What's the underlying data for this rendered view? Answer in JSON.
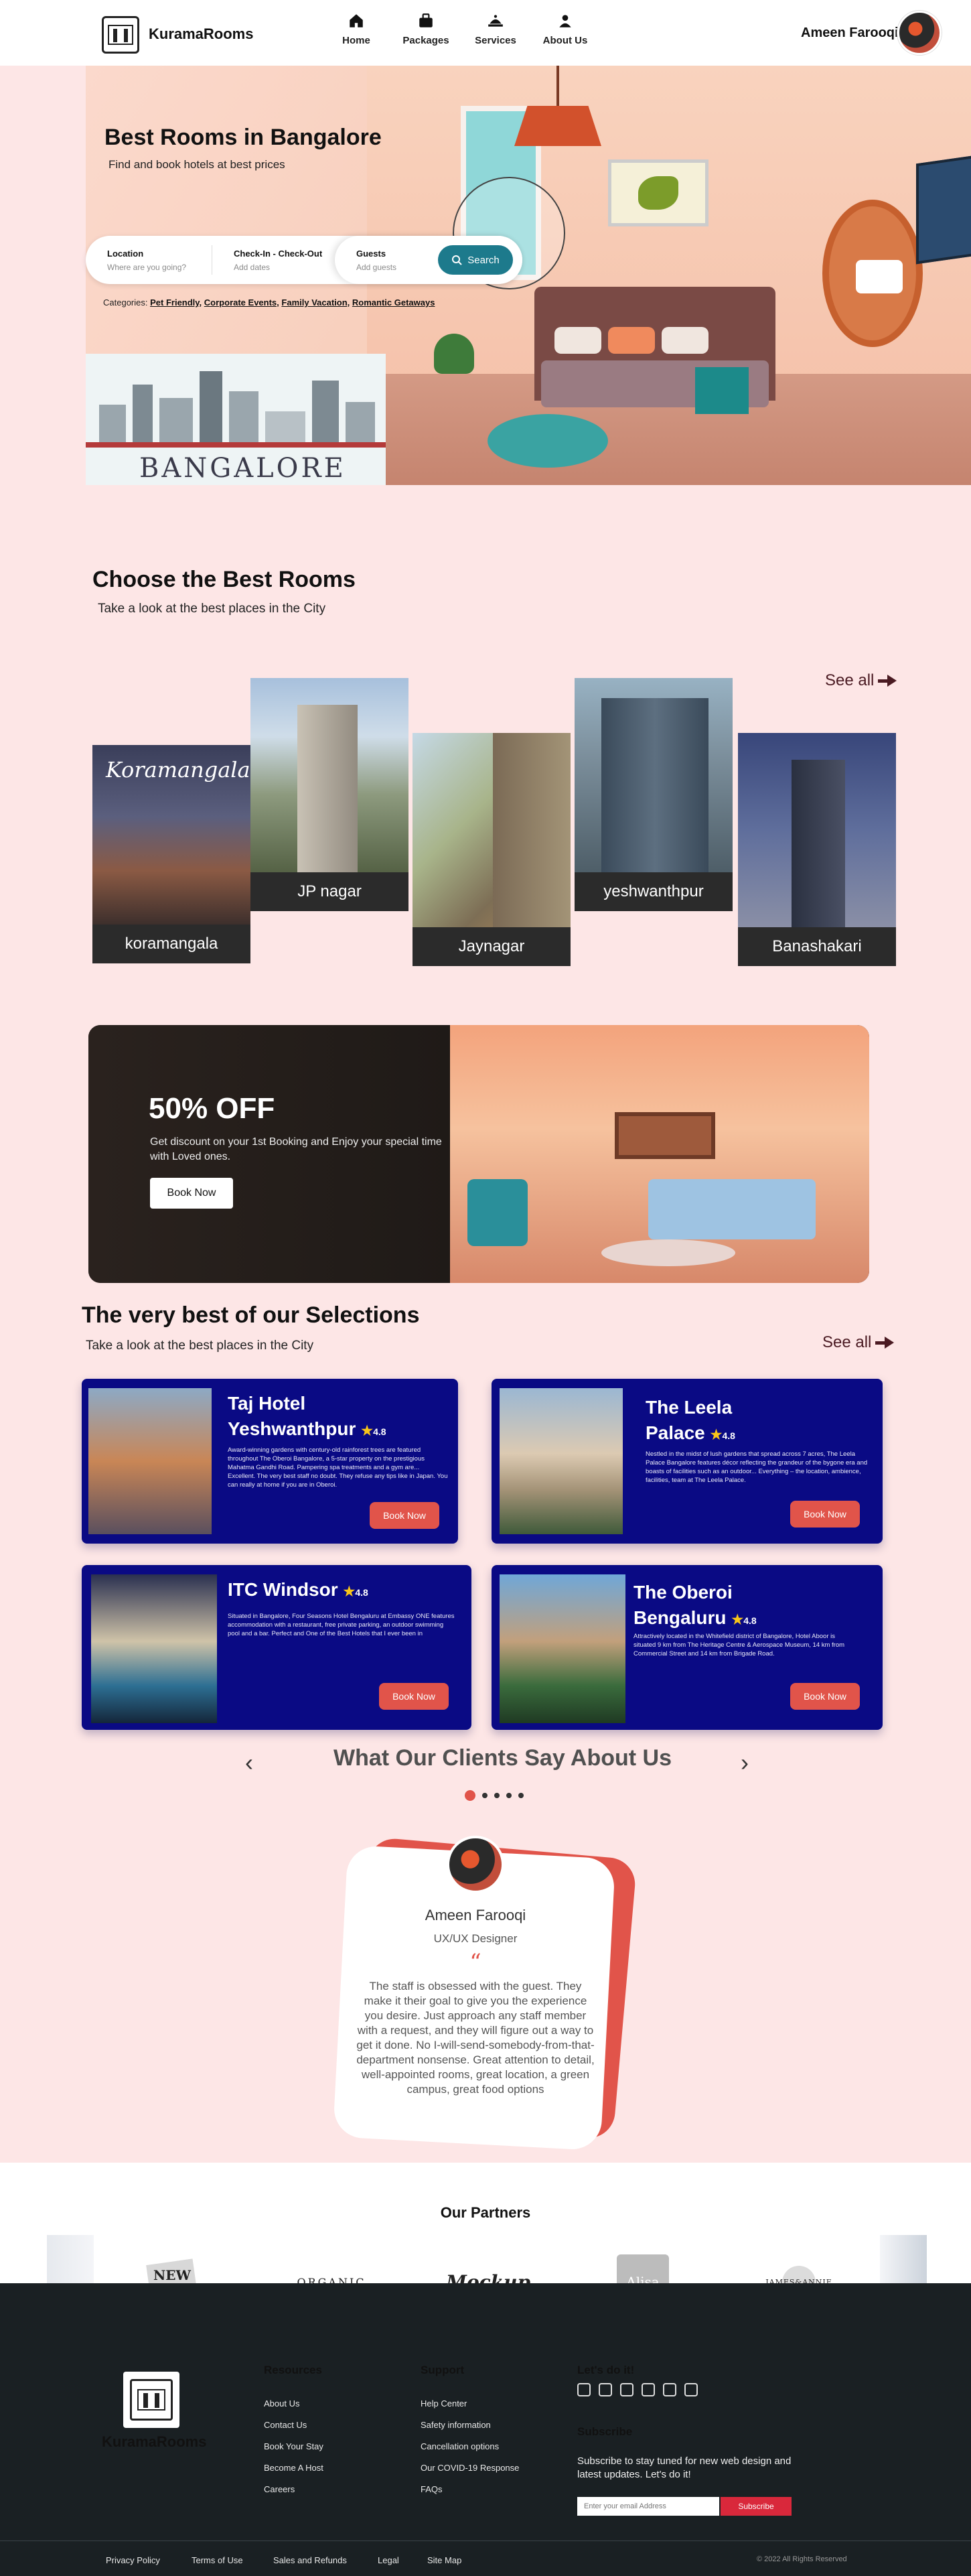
{
  "header": {
    "brand": "KuramaRooms",
    "nav": [
      {
        "label": "Home",
        "icon": "home-icon"
      },
      {
        "label": "Packages",
        "icon": "suitcase-icon"
      },
      {
        "label": "Services",
        "icon": "bell-icon"
      },
      {
        "label": "About Us",
        "icon": "user-icon"
      }
    ],
    "user_name": "Ameen Farooqi"
  },
  "hero": {
    "title": "Best Rooms in Bangalore",
    "subtitle": "Find and book hotels at best prices",
    "city_label": "BANGALORE",
    "search": {
      "location_label": "Location",
      "location_placeholder": "Where are you going?",
      "dates_label": "Check-In - Check-Out",
      "dates_placeholder": "Add dates",
      "guests_label": "Guests",
      "guests_placeholder": "Add guests",
      "button": "Search"
    },
    "categories_prefix": "Categories:",
    "categories": [
      "Pet Friendly,",
      "Corporate Events,",
      "Family Vacation,",
      "Romantic Getaways"
    ]
  },
  "rooms_section": {
    "title": "Choose the Best Rooms",
    "subtitle": "Take a look at the best places in the City",
    "see_all": "See all",
    "sign_text": "Koramangala",
    "rooms": [
      {
        "label": "koramangala"
      },
      {
        "label": "JP nagar"
      },
      {
        "label": "Jaynagar"
      },
      {
        "label": "yeshwanthpur"
      },
      {
        "label": "Banashakari"
      }
    ]
  },
  "offer": {
    "percent": "50% OFF",
    "text": "Get discount on your 1st Booking and Enjoy your special time with Loved ones.",
    "button": "Book Now"
  },
  "selections": {
    "title": "The very best of our Selections",
    "subtitle": "Take a look at the best places in the City",
    "see_all": "See all",
    "hotels": [
      {
        "name_line1": "Taj Hotel",
        "name_line2": "Yeshwanthpur",
        "rating": "4.8",
        "desc": "Award-winning gardens with century-old rainforest trees are featured throughout The Oberoi Bangalore, a 5-star property on the prestigious Mahatma Gandhi Road. Pampering spa treatments and a gym are... Excellent. The very best staff no doubt. They refuse any tips like in Japan. You can really at home if you are in Oberoi.",
        "button": "Book Now"
      },
      {
        "name_line1": "The Leela",
        "name_line2": "Palace",
        "rating": "4.8",
        "desc": "Nestled in the midst of lush gardens that spread across 7 acres, The Leela Palace Bangalore features décor reflecting the grandeur of the bygone era and boasts of facilities such as an outdoor... Everything – the location, ambience, facilities, team at The Leela Palace.",
        "button": "Book Now"
      },
      {
        "name_line1": "ITC Windsor",
        "name_line2": "",
        "rating": "4.8",
        "desc": "Situated in Bangalore, Four Seasons Hotel Bengaluru at Embassy ONE features accommodation with a restaurant, free private parking, an outdoor swimming pool and a bar. Perfect and One of the Best Hotels that I ever been in",
        "button": "Book Now"
      },
      {
        "name_line1": "The Oberoi",
        "name_line2": "Bengaluru",
        "rating": "4.8",
        "desc": "Attractively located in the Whitefield district of Bangalore, Hotel Aboor is situated 9 km from The Heritage Centre & Aerospace Museum, 14 km from Commercial Street and 14 km from Brigade Road.",
        "button": "Book Now"
      }
    ]
  },
  "testimonials": {
    "title": "What Our Clients Say About Us",
    "name": "Ameen Farooqi",
    "role": "UX/UX Designer",
    "quote_mark": "“",
    "text": "The staff is obsessed with the guest. They make it their goal to give you the experience you desire. Just approach any staff member with a request, and they will figure out a way to get it done. No I-will-send-somebody-from-that-department nonsense. Great attention to detail, well-appointed rooms, great location, a green campus, great food options"
  },
  "partners": {
    "title": "Our Partners",
    "logos": [
      "NEW WAVE",
      "ORGANIC",
      "Mockup",
      "Alisa",
      "JAMES&ANNIE"
    ]
  },
  "footer": {
    "brand": "KuramaRooms",
    "resources_title": "Resources",
    "resources": [
      "About Us",
      "Contact Us",
      "Book Your Stay",
      "Become A Host",
      "Careers"
    ],
    "support_title": "Support",
    "support": [
      "Help Center",
      "Safety information",
      "Cancellation options",
      "Our COVID-19 Response",
      "FAQs"
    ],
    "letsdo_title": "Let's do it!",
    "subscribe_title": "Subscribe",
    "subscribe_text": "Subscribe to stay tuned for new web design and latest updates. Let's do it!",
    "email_placeholder": "Enter your email Address",
    "subscribe_button": "Subscribe",
    "bottom_links": [
      "Privacy Policy",
      "Terms of Use",
      "Sales and Refunds",
      "Legal",
      "Site Map"
    ],
    "copyright": "© 2022 All Rights Reserved"
  }
}
